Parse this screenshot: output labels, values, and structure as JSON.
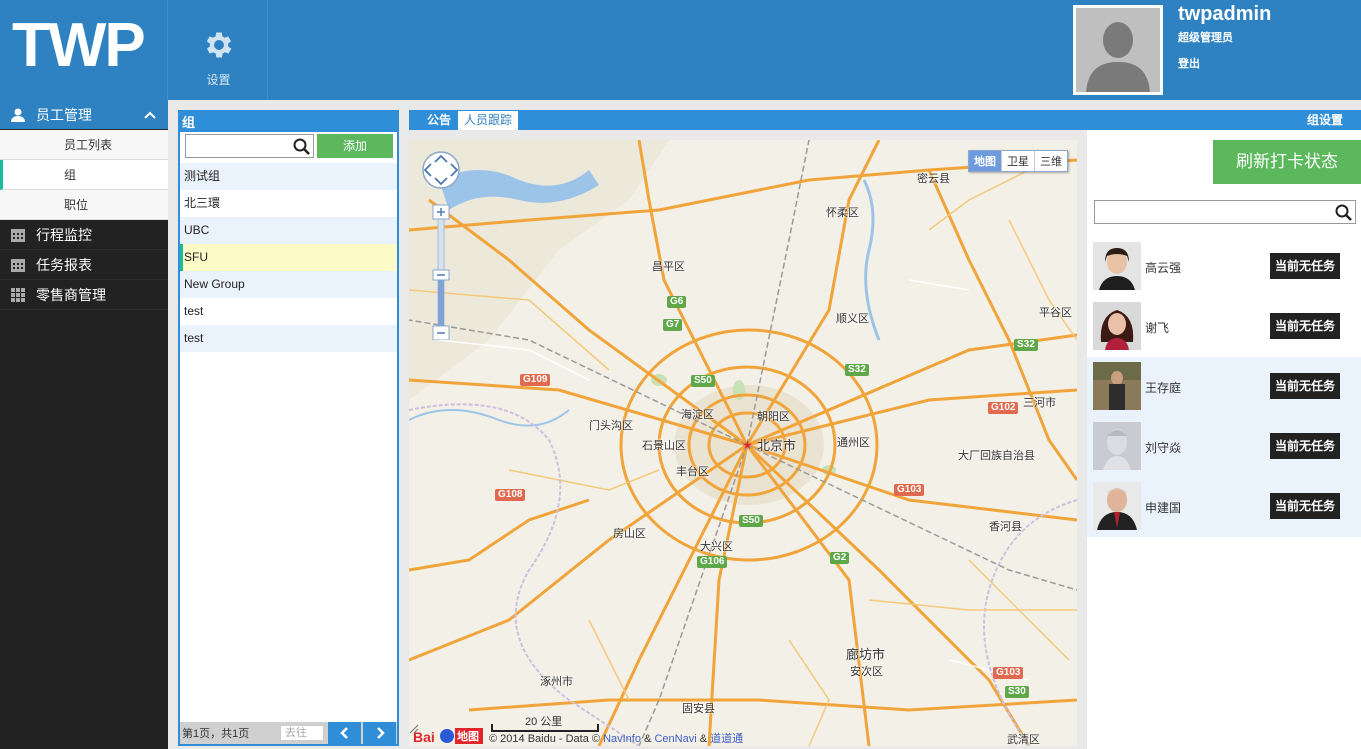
{
  "header": {
    "logo": "TWP",
    "settings_label": "设置",
    "user_name": "twpadmin",
    "user_role": "超级管理员",
    "logout": "登出"
  },
  "sidebar": {
    "sections": [
      {
        "label": "员工管理",
        "icon": "user-icon",
        "expanded": true,
        "items": [
          {
            "label": "员工列表"
          },
          {
            "label": "组"
          },
          {
            "label": "职位"
          }
        ]
      },
      {
        "label": "行程监控",
        "icon": "calendar-icon"
      },
      {
        "label": "任务报表",
        "icon": "calendar-icon"
      },
      {
        "label": "零售商管理",
        "icon": "grid-icon"
      }
    ]
  },
  "groups": {
    "title": "组",
    "search_placeholder": "",
    "add_label": "添加",
    "items": [
      "测试组",
      "北三環",
      "UBC",
      "SFU",
      "New Group",
      "test",
      "test"
    ],
    "selected_index": 3,
    "pager_info": "第1页，共1页",
    "goto_placeholder": "去往"
  },
  "tabs": {
    "notice": "公告",
    "tracking": "人员跟踪",
    "group_settings": "组设置"
  },
  "map": {
    "types": [
      "地图",
      "卫星",
      "三维"
    ],
    "active_type": "地图",
    "labels": {
      "miyun": "密云县",
      "huairou": "怀柔区",
      "changping": "昌平区",
      "shunyi": "顺义区",
      "pinggu": "平谷区",
      "sanhe": "三河市",
      "haidian": "海淀区",
      "chaoyang": "朝阳区",
      "mentougou": "门头沟区",
      "shijingshan": "石景山区",
      "beijing": "北京市",
      "tongzhou": "通州区",
      "dachang": "大厂回族自治县",
      "fengtai": "丰台区",
      "fangshan": "房山区",
      "xianghe": "香河县",
      "daxing": "大兴区",
      "langfang": "廊坊市",
      "anci": "安次区",
      "zhuozhou": "涿州市",
      "guan": "固安县",
      "wuqing": "武清区"
    },
    "highways": [
      "G6",
      "G7",
      "S50",
      "S32",
      "G109",
      "G102",
      "G108",
      "G103",
      "S50",
      "G2",
      "G106",
      "G103",
      "S30",
      "S32"
    ],
    "scale": "20 公里",
    "attribution": {
      "prefix": "© 2014 Baidu - Data ©",
      "navinfo": "NavInfo",
      "amp1": "&",
      "cennavi": "CenNavi",
      "amp2": "&",
      "daodao": "道道通"
    },
    "logo_text": "地图"
  },
  "right_panel": {
    "refresh_label": "刷新打卡状态",
    "search_placeholder": "",
    "employees": [
      {
        "name": "高云强",
        "status": "当前无任务"
      },
      {
        "name": "谢飞",
        "status": "当前无任务"
      },
      {
        "name": "王存庭",
        "status": "当前无任务"
      },
      {
        "name": "刘守焱",
        "status": "当前无任务"
      },
      {
        "name": "申建国",
        "status": "当前无任务"
      }
    ]
  },
  "colors": {
    "header_blue": "#2f82c1",
    "panel_blue": "#2f8ed8",
    "green": "#5cb85c",
    "sidebar_dark": "#222222",
    "selected_row": "#fcfac6",
    "accent_teal": "#1abc9c"
  }
}
